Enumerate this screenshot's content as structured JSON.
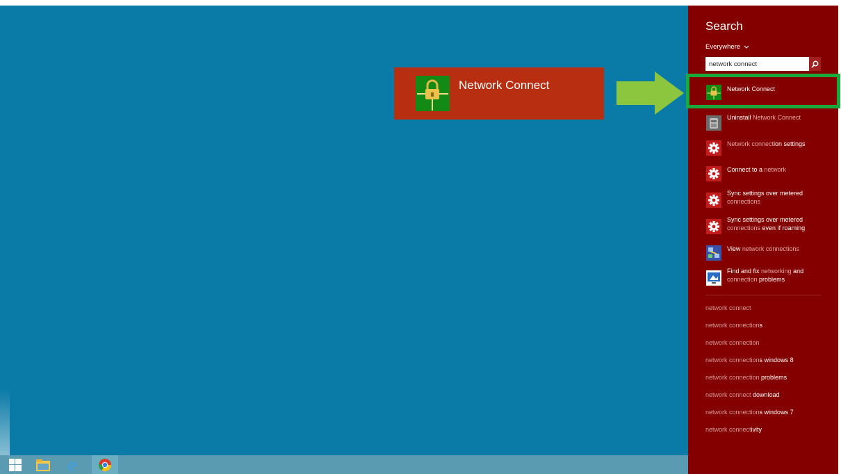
{
  "charms": {
    "title": "Search",
    "scope": "Everywhere",
    "search_value": "network connect",
    "results": [
      {
        "icon": "lock-icon",
        "parts": [
          {
            "t": "Network Connect",
            "dim": false
          }
        ]
      },
      {
        "icon": "uninstall-icon",
        "parts": [
          {
            "t": "Uninstall ",
            "dim": false
          },
          {
            "t": "Network Connect",
            "dim": true
          }
        ]
      },
      {
        "icon": "gear-icon",
        "parts": [
          {
            "t": "Network connect",
            "dim": true
          },
          {
            "t": "ion settings",
            "dim": false
          }
        ]
      },
      {
        "icon": "gear-icon",
        "parts": [
          {
            "t": "Connect to a ",
            "dim": false
          },
          {
            "t": "network",
            "dim": true
          }
        ]
      },
      {
        "icon": "gear-icon",
        "parts": [
          {
            "t": "Sync settings over metered ",
            "dim": false
          },
          {
            "t": "connections",
            "dim": true
          }
        ]
      },
      {
        "icon": "gear-icon",
        "parts": [
          {
            "t": "Sync settings over metered ",
            "dim": false
          },
          {
            "t": "connections",
            "dim": true
          },
          {
            "t": " even if roaming",
            "dim": false
          }
        ]
      },
      {
        "icon": "network-view-icon",
        "parts": [
          {
            "t": "View ",
            "dim": false
          },
          {
            "t": "network connections",
            "dim": true
          }
        ]
      },
      {
        "icon": "troubleshoot-icon",
        "parts": [
          {
            "t": "Find and fix ",
            "dim": false
          },
          {
            "t": "networking",
            "dim": true
          },
          {
            "t": " and ",
            "dim": false
          },
          {
            "t": "connection",
            "dim": true
          },
          {
            "t": " problems",
            "dim": false
          }
        ]
      }
    ],
    "suggestions": [
      {
        "dim": "network connect",
        "rest": ""
      },
      {
        "dim": "network connection",
        "rest": "s"
      },
      {
        "dim": "network connection",
        "rest": ""
      },
      {
        "dim": "network connection",
        "rest": "s windows 8"
      },
      {
        "dim": "network connection",
        "rest": " problems"
      },
      {
        "dim": "network connect",
        "rest": " download"
      },
      {
        "dim": "network connection",
        "rest": "s windows 7"
      },
      {
        "dim": "network connect",
        "rest": "ivity"
      }
    ]
  },
  "tile": {
    "label": "Network Connect",
    "icon": "lock-icon"
  },
  "taskbar": {
    "items": [
      "windows-start-icon",
      "file-explorer-icon",
      "internet-explorer-icon",
      "chrome-icon"
    ]
  },
  "colors": {
    "desktop": "#0a7aa6",
    "charms_bg": "#840000",
    "tile_bg": "#b82e10",
    "highlight": "#1aaa3c",
    "arrow": "#8cc63f"
  }
}
